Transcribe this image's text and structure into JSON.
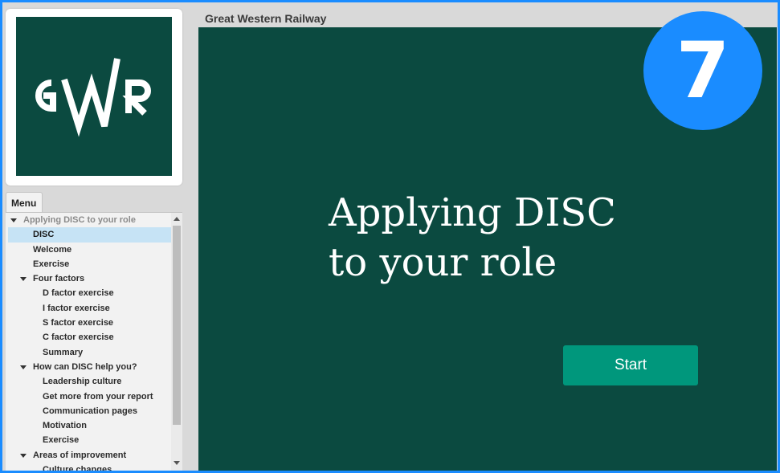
{
  "app": {
    "title": "Great Western Railway",
    "logo_text": "GWR",
    "badge": "7"
  },
  "colors": {
    "brand_green": "#0b4a40",
    "accent_teal": "#00977c",
    "badge_blue": "#1a8cff"
  },
  "menu": {
    "tab_label": "Menu",
    "items": [
      {
        "label": "Applying DISC to your role",
        "level": 0,
        "caret": true,
        "dim": true
      },
      {
        "label": "DISC",
        "level": 1,
        "selected": true
      },
      {
        "label": "Welcome",
        "level": 1
      },
      {
        "label": "Exercise",
        "level": 1
      },
      {
        "label": "Four factors",
        "level": 1,
        "caret": true
      },
      {
        "label": "D factor exercise",
        "level": 2
      },
      {
        "label": "I factor exercise",
        "level": 2
      },
      {
        "label": "S factor exercise",
        "level": 2
      },
      {
        "label": "C factor exercise",
        "level": 2
      },
      {
        "label": "Summary",
        "level": 2
      },
      {
        "label": "How can DISC help you?",
        "level": 1,
        "caret": true
      },
      {
        "label": "Leadership culture",
        "level": 2
      },
      {
        "label": "Get more from your report",
        "level": 2
      },
      {
        "label": "Communication pages",
        "level": 2
      },
      {
        "label": "Motivation",
        "level": 2
      },
      {
        "label": "Exercise",
        "level": 2
      },
      {
        "label": "Areas of improvement",
        "level": 1,
        "caret": true
      },
      {
        "label": "Culture changes",
        "level": 2
      }
    ]
  },
  "slide": {
    "title_line1": "Applying DISC",
    "title_line2": "to your role",
    "start_label": "Start"
  }
}
